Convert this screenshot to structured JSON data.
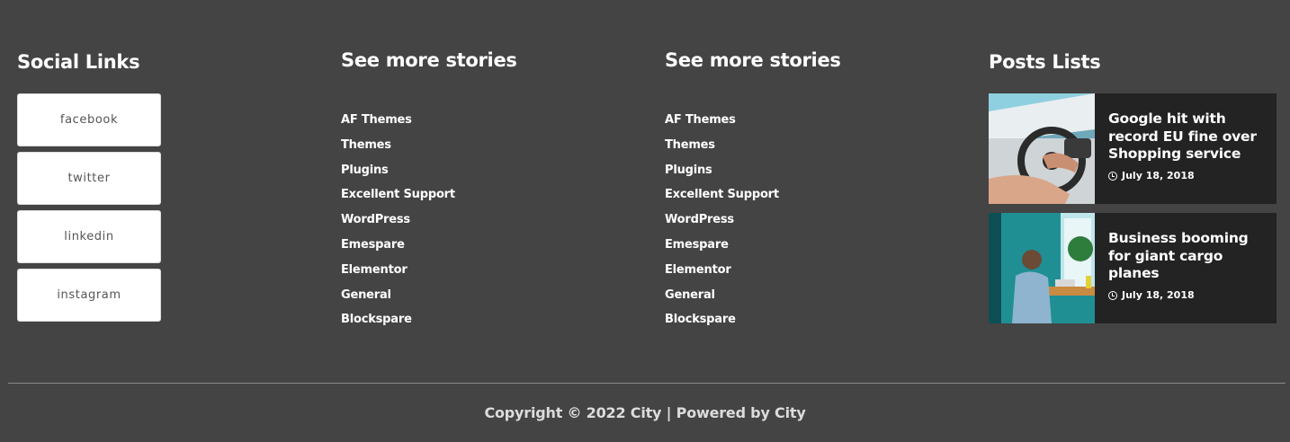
{
  "social": {
    "title": "Social Links",
    "links": [
      {
        "label": "facebook"
      },
      {
        "label": "twitter"
      },
      {
        "label": "linkedin"
      },
      {
        "label": "instagram"
      }
    ]
  },
  "stories_1": {
    "title": "See more stories",
    "links": [
      "AF Themes",
      "Themes",
      "Plugins",
      "Excellent Support",
      "WordPress",
      "Emespare",
      "Elementor",
      "General",
      "Blockspare"
    ]
  },
  "stories_2": {
    "title": "See more stories",
    "links": [
      "AF Themes",
      "Themes",
      "Plugins",
      "Excellent Support",
      "WordPress",
      "Emespare",
      "Elementor",
      "General",
      "Blockspare"
    ]
  },
  "posts": {
    "title": "Posts Lists",
    "items": [
      {
        "title": "Google hit with record EU fine over Shopping service",
        "date": "July 18, 2018",
        "thumb": "boat-steering-wheel-photo"
      },
      {
        "title": "Business booming for giant cargo planes",
        "date": "July 18, 2018",
        "thumb": "man-at-desk-photo"
      }
    ]
  },
  "footer": {
    "copyright": "Copyright © 2022 City | Powered by City"
  },
  "colors": {
    "background": "#444444",
    "post_card": "#232323",
    "text": "#ffffff",
    "divider": "#8a8a8a"
  }
}
